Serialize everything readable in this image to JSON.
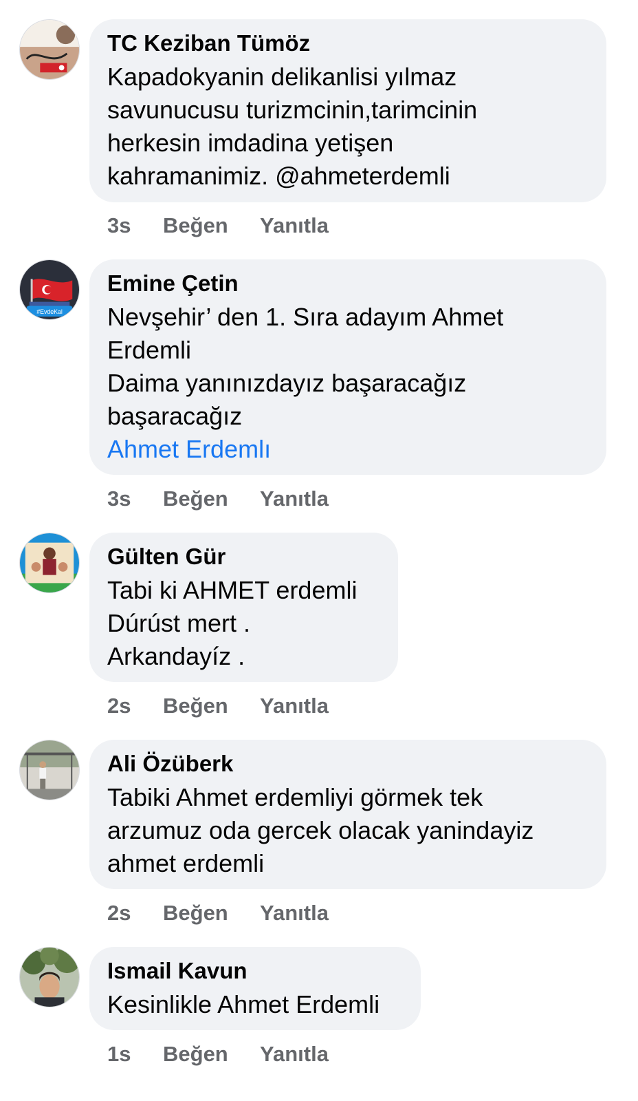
{
  "comments": [
    {
      "author": "TC Keziban Tümöz",
      "lines": [
        "Kapadokyanin delikanlisi yılmaz",
        "savunucusu turizmcinin,tarimcinin",
        "herkesin imdadina yetişen",
        "kahramanimiz. @ahmeterdemli"
      ],
      "time": "3s",
      "like_label": "Beğen",
      "reply_label": "Yanıtla"
    },
    {
      "author": "Emine Çetin",
      "lines": [
        "Nevşehir’ den 1. Sıra adayım Ahmet",
        "Erdemli",
        "Daima yanınızdayız başaracağız",
        "başaracağız"
      ],
      "tag": "Ahmet Erdemlı",
      "avatar_badge": "#EvdeKal",
      "time": "3s",
      "like_label": "Beğen",
      "reply_label": "Yanıtla"
    },
    {
      "author": "Gülten Gür",
      "lines": [
        "Tabi ki  AHMET erdemli",
        "Dúrúst mert .",
        "Arkandayíz ."
      ],
      "time": "2s",
      "like_label": "Beğen",
      "reply_label": "Yanıtla"
    },
    {
      "author": "Ali Özüberk",
      "lines": [
        "Tabiki Ahmet erdemliyi görmek tek",
        "arzumuz oda gercek olacak yanindayiz",
        "ahmet erdemli"
      ],
      "time": "2s",
      "like_label": "Beğen",
      "reply_label": "Yanıtla"
    },
    {
      "author": "Ismail Kavun",
      "lines": [
        "Kesinlikle Ahmet Erdemli"
      ],
      "time": "1s",
      "like_label": "Beğen",
      "reply_label": "Yanıtla"
    }
  ],
  "colors": {
    "bubble_bg": "#f0f2f5",
    "text": "#050505",
    "meta": "#65676b",
    "link": "#1877f2"
  }
}
